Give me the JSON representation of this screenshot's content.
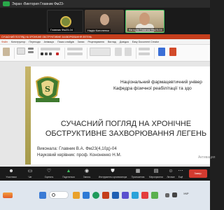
{
  "window": {
    "title": "Экран -Виктория Главник Фм23-"
  },
  "participants": [
    {
      "name": "Главник Фм23-04"
    },
    {
      "name": "Надія Кононенко"
    },
    {
      "name": "Вікторія Главник Фм23-04"
    }
  ],
  "powerpoint": {
    "title_bar": "СУЧАСНИЙ ПОГЛЯД НА ХРОНІЧНЕ ОБСТРУКТИВНЕ ЗАХВОРЮВАННЯ ЛЕГЕНЬ",
    "tabs": [
      "Файл",
      "Конструктор",
      "Переходи",
      "Анімація",
      "Показ слайдів",
      "Запис",
      "Рецензування",
      "Вигляд",
      "Довідка",
      "Easy Document Creator"
    ],
    "active_tab": "Файл"
  },
  "slide": {
    "university_line1": "Національний фармацевтичний універ",
    "university_line2": "Кафедра фізичної реабілітації та здо",
    "title_line1": "СУЧАСНИЙ ПОГЛЯД НА ХРОНІЧНЕ",
    "title_line2": "ОБСТРУКТИВНЕ ЗАХВОРЮВАННЯ ЛЕГЕНЬ",
    "author_line": "Виконала: Главник В.А. Фм23(4,10д)-04",
    "supervisor_line": "Науковий керівник: проф. Кононенко Н.М.",
    "watermark": "Активация"
  },
  "controls": [
    {
      "label": "Участники",
      "icon": "people-icon"
    },
    {
      "label": "Чат",
      "icon": "chat-icon"
    },
    {
      "label": "Оценить",
      "icon": "heart-icon"
    },
    {
      "label": "Поделиться",
      "icon": "share-icon"
    },
    {
      "label": "Запись",
      "icon": "record-icon"
    },
    {
      "label": "Инструменты организатора",
      "icon": "shield-icon"
    },
    {
      "label": "Приложения",
      "icon": "apps-icon"
    },
    {
      "label": "Мероприятия",
      "icon": "calendar-icon"
    },
    {
      "label": "Личные",
      "icon": "person-icon"
    },
    {
      "label": "Ещё",
      "icon": "more-icon"
    }
  ],
  "exit_label": "Завер.",
  "taskbar": {
    "tray_lang": "УКР"
  },
  "colors": {
    "ppt_accent": "#c43e1c",
    "zoom_green": "#29a84a",
    "exit_red": "#d33a2f"
  }
}
